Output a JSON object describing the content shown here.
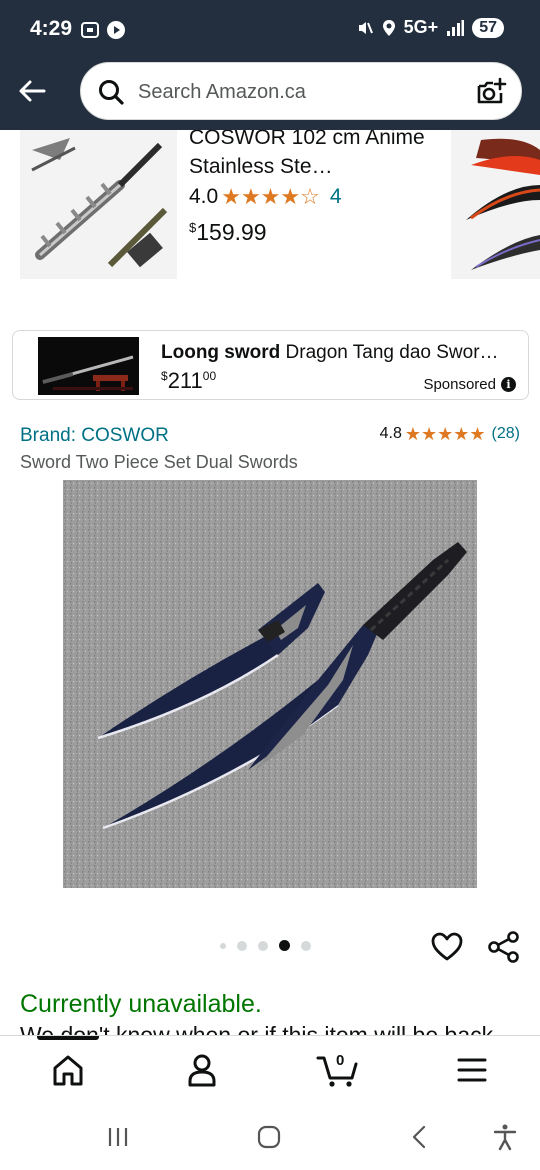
{
  "status_bar": {
    "time": "4:29",
    "network": "5G+",
    "battery": "57"
  },
  "search": {
    "placeholder": "Search Amazon.ca"
  },
  "carousel": {
    "title": "COSWOR 102 cm Anime Stainless Ste…",
    "rating": "4.0",
    "rating_value": 4,
    "review_count": "4",
    "price_symbol": "$",
    "price": "159.99"
  },
  "sponsored": {
    "title_bold": "Loong sword",
    "title_rest": " Dragon Tang dao Swor…",
    "price_symbol": "$",
    "price_whole": "211",
    "price_fraction": "00",
    "label": "Sponsored"
  },
  "product": {
    "brand": "Brand: COSWOR",
    "rating": "4.8",
    "rating_value": 4.8,
    "review_count": "(28)",
    "title": "Sword Two Piece Set Dual Swords",
    "image_count": 5,
    "active_image": 4
  },
  "availability": {
    "status": "Currently unavailable.",
    "note": "We don't know when or if this item will be back"
  },
  "bottom_nav": {
    "cart_count": "0"
  },
  "colors": {
    "header": "#232f3e",
    "link": "#007185",
    "star": "#de7921",
    "available": "#007600"
  }
}
